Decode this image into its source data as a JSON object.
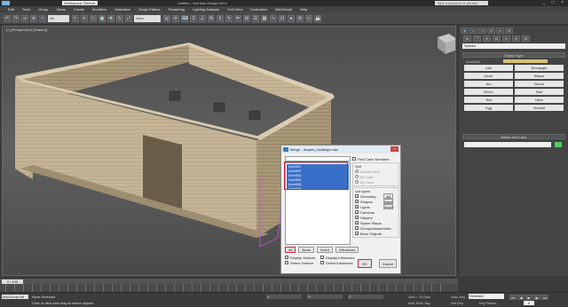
{
  "titlebar": {
    "workspace": "Workspace: Default",
    "title": "Untitled - 3ds Max Design 2014",
    "search_placeholder": "Type a keyword or phrase",
    "window_controls": "_ □ ×"
  },
  "menubar": [
    "Edit",
    "Tools",
    "Group",
    "Views",
    "Create",
    "Modifiers",
    "Animation",
    "Graph Editors",
    "Rendering",
    "Lighting Analysis",
    "Civil View",
    "Customize",
    "MAXScript",
    "Help"
  ],
  "toolbar": {
    "selection_filter": "All",
    "view_dropdown": "View"
  },
  "viewport": {
    "label": "[+] [Perspective] [Shaded]"
  },
  "command_panel": {
    "category": "Splines",
    "object_type_title": "Object Type",
    "autogrid_label": "AutoGrid",
    "start_new_shape": "Start New Shape",
    "buttons": [
      "Line",
      "Rectangle",
      "Circle",
      "Ellipse",
      "Arc",
      "Donut",
      "NGon",
      "Star",
      "Text",
      "Helix",
      "Egg",
      "Section"
    ],
    "name_color_title": "Name and Color",
    "name_color_hex": "#4bd15a"
  },
  "dialog": {
    "title": "Merge - drapes_moldings.max",
    "close": "×",
    "list_items": [
      "Line001",
      "Line002",
      "Line003",
      "Line004",
      "Line005",
      "Line006"
    ],
    "find_case": "Find Case Sensitive",
    "sort_label": "Sort",
    "sort_alpha": "Alphabetical",
    "sort_type": "By Type",
    "sort_color": "By Color",
    "list_types_label": "List types",
    "types": [
      "Geometry",
      "Shapes",
      "Lights",
      "Cameras",
      "Helpers",
      "Space Warps",
      "Groups/Assemblies",
      "Bone Objects"
    ],
    "all_btn": "All",
    "none_btn": "None",
    "invert_btn": "Invert",
    "bottom_all": "All",
    "bottom_none": "None",
    "bottom_invert": "Invert",
    "influences": "Influences",
    "display_subtree": "Display Subtree",
    "display_influences": "Display Influences",
    "select_subtree": "Select Subtree",
    "select_influences": "Select Influences",
    "ok": "OK",
    "cancel": "Cancel"
  },
  "timeline": {
    "slider": "0 / 100",
    "ticks": [
      "0",
      "10",
      "20",
      "30",
      "40",
      "50",
      "60",
      "70",
      "80",
      "90",
      "100"
    ]
  },
  "statusbar": {
    "maxscript": "MAXScript Mi",
    "message1": "None Selected",
    "message2": "Click or click-and-drag to select objects",
    "x": "X:",
    "y": "Y:",
    "z": "Z:",
    "grid": "Grid = 10.0cm",
    "add_time_tag": "Add Time Tag",
    "auto_key": "Auto Key",
    "selected": "Selected",
    "set_key": "Set Key",
    "key_filters": "Key Filters...",
    "frame": "0"
  }
}
